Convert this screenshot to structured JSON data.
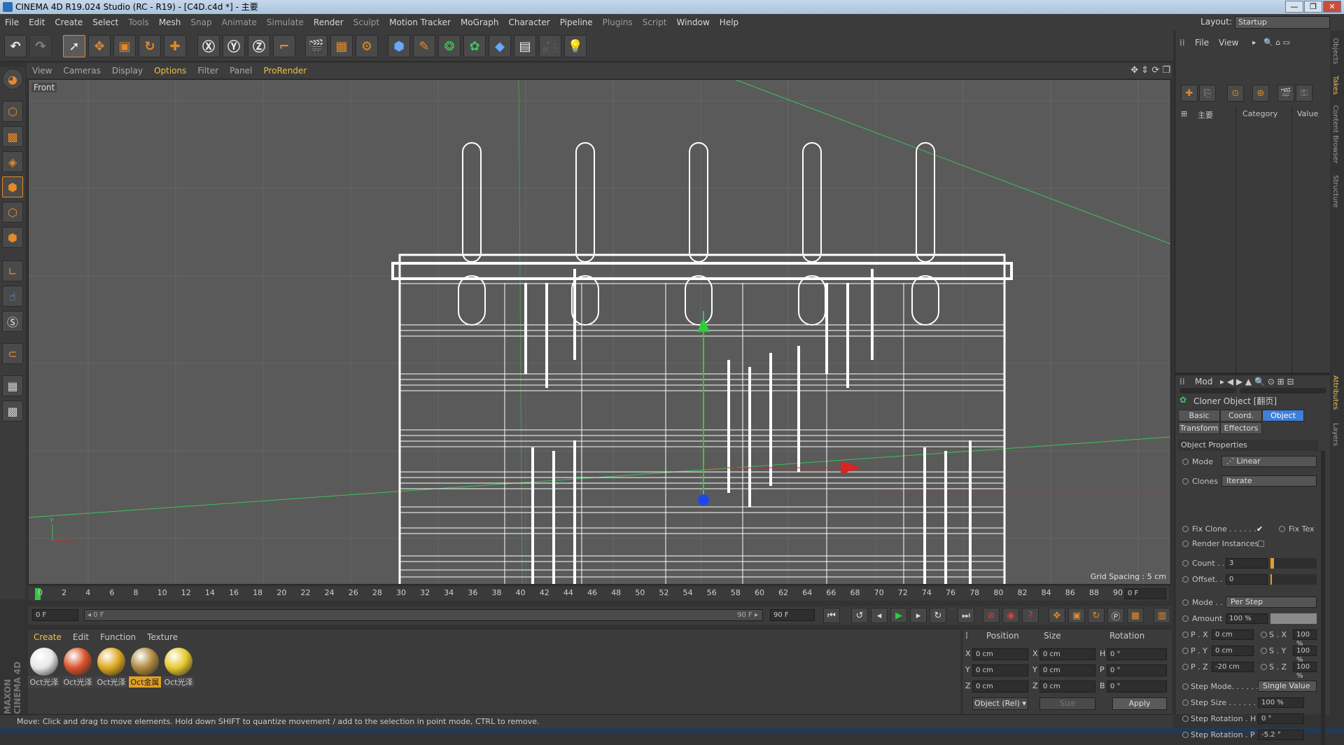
{
  "title": "CINEMA 4D R19.024 Studio (RC - R19) - [C4D.c4d *] - 主要",
  "window_buttons": [
    "—",
    "❐",
    "✕"
  ],
  "menu": [
    "File",
    "Edit",
    "Create",
    "Select",
    "Tools",
    "Mesh",
    "Snap",
    "Animate",
    "Simulate",
    "Render",
    "Sculpt",
    "Motion Tracker",
    "MoGraph",
    "Character",
    "Pipeline",
    "Plugins",
    "Script",
    "Window",
    "Help"
  ],
  "layout": {
    "label": "Layout:",
    "value": "Startup"
  },
  "viewport": {
    "menu": [
      "View",
      "Cameras",
      "Display",
      "Options",
      "Filter",
      "Panel",
      "ProRender"
    ],
    "active_menu": "Options",
    "camera_label": "Front",
    "grid_spacing": "Grid Spacing : 5 cm",
    "axis_y": "Y",
    "axis_x": "X"
  },
  "timeline": {
    "ticks": [
      "0",
      "2",
      "4",
      "6",
      "8",
      "10",
      "12",
      "14",
      "16",
      "18",
      "20",
      "22",
      "24",
      "26",
      "28",
      "30",
      "32",
      "34",
      "36",
      "38",
      "40",
      "42",
      "44",
      "46",
      "48",
      "50",
      "52",
      "54",
      "56",
      "58",
      "60",
      "62",
      "64",
      "66",
      "68",
      "70",
      "72",
      "74",
      "76",
      "78",
      "80",
      "82",
      "84",
      "86",
      "88",
      "90"
    ],
    "current_frame": "0 F"
  },
  "transport": {
    "start_field": "0 F",
    "range_start": "◂ 0 F",
    "range_end": "90 F ▸",
    "end_field": "90 F"
  },
  "materials": {
    "menu": [
      "Create",
      "Edit",
      "Function",
      "Texture"
    ],
    "active_menu": "Create",
    "items": [
      {
        "label": "Oct光泽",
        "color": "#e8e8e8",
        "selected": false
      },
      {
        "label": "Oct光泽",
        "color": "#d9532b",
        "selected": false
      },
      {
        "label": "Oct光泽",
        "color": "#e0a820",
        "selected": false
      },
      {
        "label": "Oct金属",
        "color": "#b08a40",
        "selected": true
      },
      {
        "label": "Oct光泽",
        "color": "#e8c830",
        "selected": false
      }
    ]
  },
  "coordinates": {
    "headers": [
      "Position",
      "Size",
      "Rotation"
    ],
    "rows": [
      {
        "pl": "X",
        "pv": "0 cm",
        "sl": "X",
        "sv": "0 cm",
        "rl": "H",
        "rv": "0 °"
      },
      {
        "pl": "Y",
        "pv": "0 cm",
        "sl": "Y",
        "sv": "0 cm",
        "rl": "P",
        "rv": "0 °"
      },
      {
        "pl": "Z",
        "pv": "0 cm",
        "sl": "Z",
        "sv": "0 cm",
        "rl": "B",
        "rv": "0 °"
      }
    ],
    "mode_select": "Object (Rel) ▾",
    "size_select": "Size",
    "apply": "Apply"
  },
  "status": "Move: Click and drag to move elements. Hold down SHIFT to quantize movement / add to the selection in point mode, CTRL to remove.",
  "maxon": "MAXON CINEMA 4D",
  "objects_panel": {
    "menu": [
      "File",
      "View"
    ],
    "root": "主要",
    "columns": [
      "Category",
      "Value"
    ]
  },
  "attributes": {
    "menu": "Mod",
    "object_title": "Cloner Object [翻页]",
    "tabs": [
      "Basic",
      "Coord.",
      "Object",
      "Transform",
      "Effectors"
    ],
    "active_tab": "Object",
    "section": "Object Properties",
    "mode_label": "Mode",
    "mode_value": "⋰ Linear",
    "clones_label": "Clones",
    "clones_value": "Iterate",
    "fix_clone": "Fix Clone . . . . . .",
    "fix_texture": "Fix Tex",
    "render_instances": "Render Instances",
    "count_label": "Count . .",
    "count_value": "3",
    "offset_label": "Offset. .",
    "offset_value": "0",
    "mode2_label": "Mode . .",
    "mode2_value": "Per Step",
    "amount_label": "Amount",
    "amount_value": "100 %",
    "pos": [
      {
        "label": "P . X",
        "value": "0 cm",
        "slabel": "S . X",
        "svalue": "100 %"
      },
      {
        "label": "P . Y",
        "value": "0 cm",
        "slabel": "S . Y",
        "svalue": "100 %"
      },
      {
        "label": "P . Z",
        "value": "-20 cm",
        "slabel": "S . Z",
        "svalue": "100 %"
      }
    ],
    "step_mode_label": "Step Mode. . . . . . . .",
    "step_mode_value": "Single Value",
    "step_size_label": "Step Size . . . . . . . .",
    "step_size_value": "100 %",
    "step_rot_h_label": "Step Rotation . H",
    "step_rot_h_value": "0 °",
    "step_rot_p_label": "Step Rotation . P",
    "step_rot_p_value": "-5.2 °"
  },
  "right_tabs": [
    "Objects",
    "Takes",
    "Content Browser",
    "Structure",
    "Attributes",
    "Layers"
  ],
  "colors": {
    "accent": "#f0c040",
    "selected_tab": "#3f7fd8",
    "bg": "#3b3b3b",
    "viewport": "#5a5a5a"
  }
}
